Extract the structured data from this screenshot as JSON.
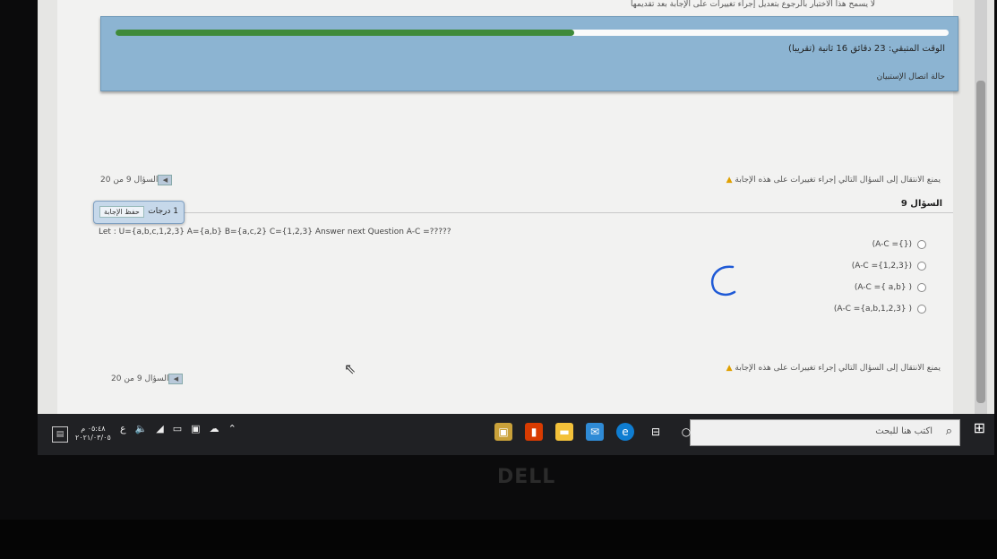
{
  "top_note": "لا يسمح هذا الاختبار بالرجوع بتعديل إجراء تغييرات على الإجابة بعد تقديمها",
  "timer": {
    "label": "الوقت المتبقي: 23 دقائق 16 ثانية (تقريبا)",
    "progress_pct": 55,
    "status_link": "حالة اتصال الإستبيان"
  },
  "navigation_warning": "يمنع الانتقال إلى السؤال التالي إجراء تغييرات على هذه الإجابة",
  "question_counter": "السؤال 9 من 20",
  "question_heading": "السؤال 9",
  "points": {
    "marks_label": "1 درجات",
    "save_label": "حفظ الإجابة"
  },
  "question_text": "Let : U={a,b,c,1,2,3} A={a,b} B={a,c,2} C={1,2,3} Answer next Question A-C =?????",
  "options": [
    {
      "label": "(A-C ={})"
    },
    {
      "label": "(A-C ={1,2,3})"
    },
    {
      "label": "(A-C ={ a,b} )"
    },
    {
      "label": "(A-C ={a,b,1,2,3} )"
    }
  ],
  "taskbar": {
    "search_placeholder": "اكتب هنا للبحث",
    "clock_time": "٠٥:٤٨ م",
    "clock_date": "٢٠٢١/٠٣/٠٥",
    "lang": "ع"
  },
  "brand": "DELL"
}
